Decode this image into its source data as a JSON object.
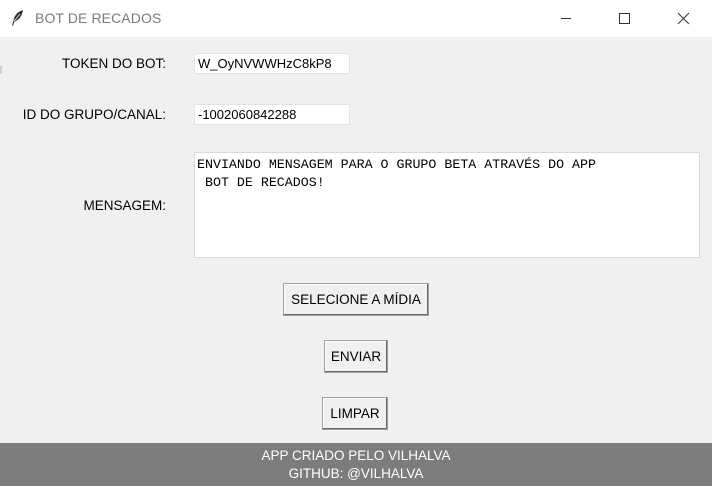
{
  "window": {
    "title": "BOT DE RECADOS",
    "icon": "feather-icon",
    "controls": [
      "minimize-icon",
      "maximize-icon",
      "close-icon"
    ]
  },
  "form": {
    "token_label": "TOKEN DO BOT:",
    "token_value": "W_OyNVWWHzC8kP8",
    "group_label": "ID DO GRUPO/CANAL:",
    "group_value": "-1002060842288",
    "message_label": "MENSAGEM:",
    "message_value": "ENVIANDO MENSAGEM PARA O GRUPO BETA ATRAVÉS DO APP\n BOT DE RECADOS!"
  },
  "buttons": {
    "select_media": "SELECIONE A MÍDIA",
    "send": "ENVIAR",
    "clear": "LIMPAR"
  },
  "footer": {
    "line1": "APP CRIADO PELO VILHALVA",
    "line2": "GITHUB: @VILHALVA"
  },
  "colors": {
    "background": "#f0f0f0",
    "footer_bg": "#7c7c7c",
    "footer_text": "#ffffff"
  }
}
